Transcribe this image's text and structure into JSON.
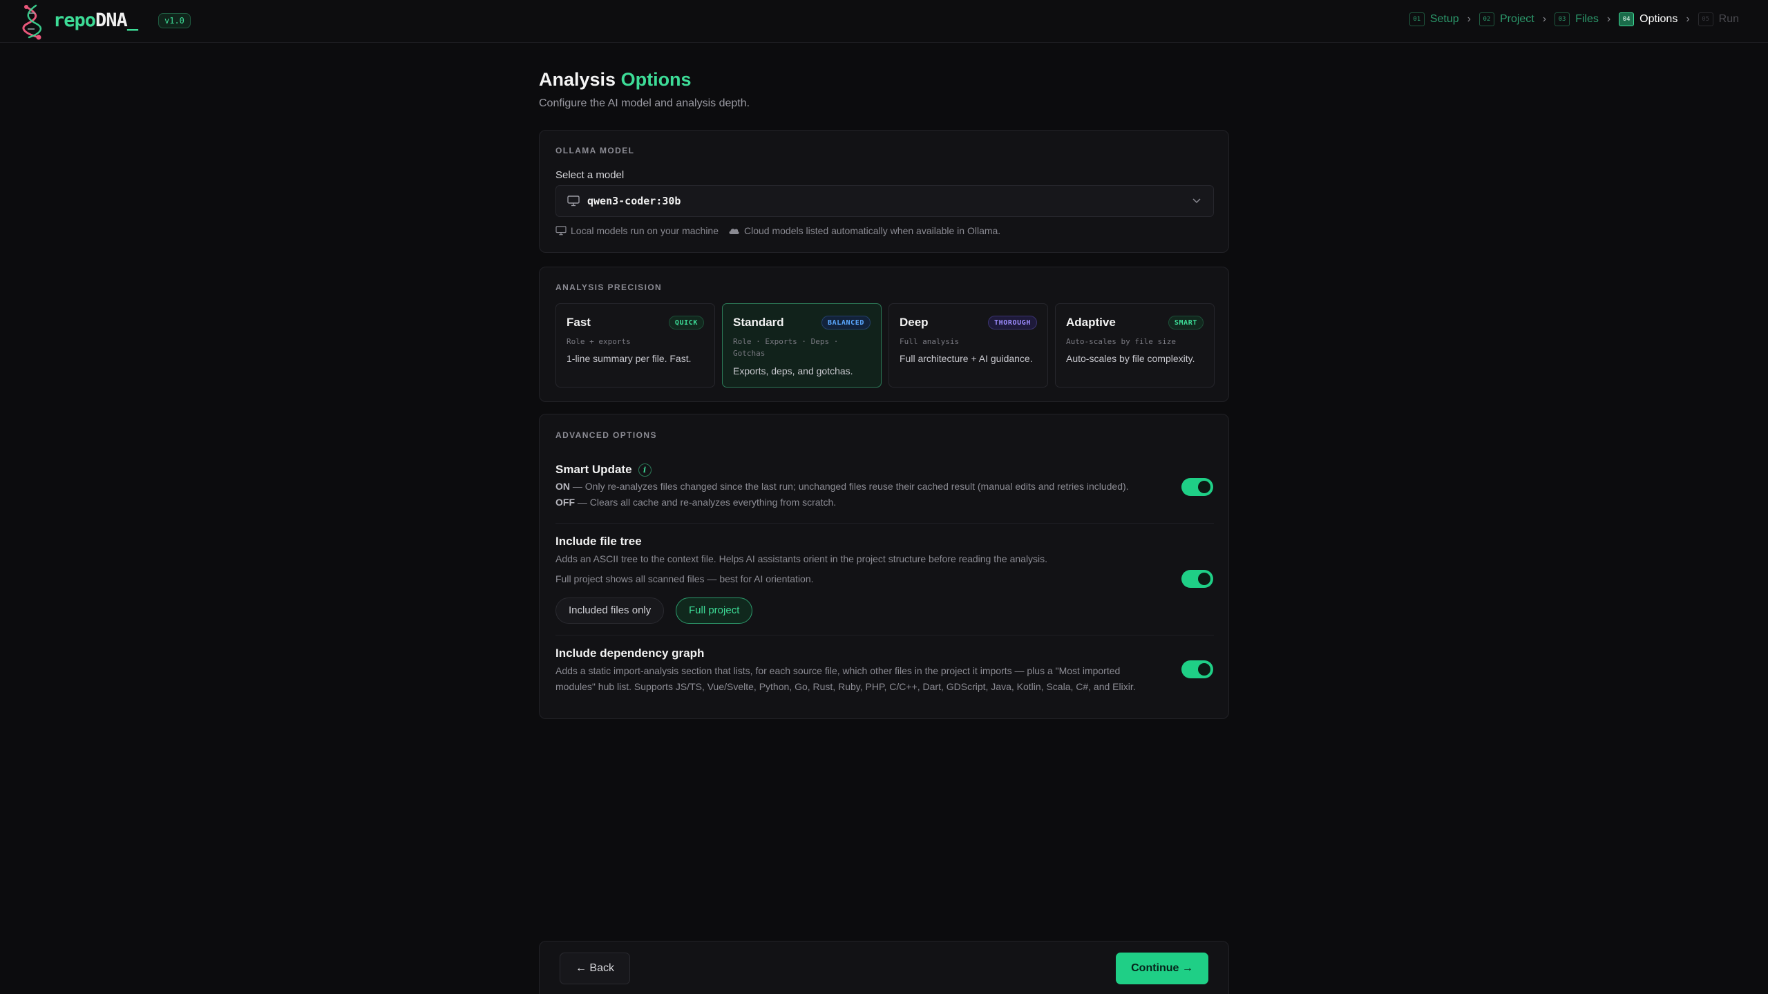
{
  "app": {
    "logo_repo": "repo",
    "logo_dna": "DNA",
    "logo_cursor": "_",
    "version": "v1.0"
  },
  "steps": [
    {
      "num": "01",
      "label": "Setup",
      "state": "done"
    },
    {
      "num": "02",
      "label": "Project",
      "state": "done"
    },
    {
      "num": "03",
      "label": "Files",
      "state": "done"
    },
    {
      "num": "04",
      "label": "Options",
      "state": "active"
    },
    {
      "num": "05",
      "label": "Run",
      "state": "future"
    }
  ],
  "step_separator": "›",
  "page": {
    "title_part1": "Analysis",
    "title_part2": "Options",
    "subtitle": "Configure the AI model and analysis depth."
  },
  "model": {
    "section_label": "OLLAMA MODEL",
    "select_label": "Select a model",
    "selected_value": "qwen3-coder:30b",
    "hint_local": "Local models run on your machine",
    "hint_cloud": "Cloud models listed automatically when available in Ollama."
  },
  "precision": {
    "section_label": "ANALYSIS PRECISION",
    "selected": "Standard",
    "tiles": [
      {
        "name": "Fast",
        "badge": "QUICK",
        "meta": "Role + exports",
        "desc": "1-line summary per file. Fast."
      },
      {
        "name": "Standard",
        "badge": "BALANCED",
        "meta": "Role · Exports · Deps · Gotchas",
        "desc": "Exports, deps, and gotchas."
      },
      {
        "name": "Deep",
        "badge": "THOROUGH",
        "meta": "Full analysis",
        "desc": "Full architecture + AI guidance."
      },
      {
        "name": "Adaptive",
        "badge": "SMART",
        "meta": "Auto-scales by file size",
        "desc": "Auto-scales by file complexity."
      }
    ]
  },
  "advanced": {
    "section_label": "ADVANCED OPTIONS",
    "smart_update": {
      "title": "Smart Update",
      "info": "i",
      "on_label": "ON",
      "on_text": "— Only re-analyzes files changed since the last run; unchanged files reuse their cached result (manual edits and retries included).",
      "off_label": "OFF",
      "off_text": "— Clears all cache and re-analyzes everything from scratch.",
      "enabled": true
    },
    "file_tree": {
      "title": "Include file tree",
      "desc": "Adds an ASCII tree to the context file. Helps AI assistants orient in the project structure before reading the analysis.",
      "mode_desc": "Full project shows all scanned files — best for AI orientation.",
      "option_included": "Included files only",
      "option_full": "Full project",
      "selected": "Full project",
      "enabled": true
    },
    "dep_graph": {
      "title": "Include dependency graph",
      "desc": "Adds a static import-analysis section that lists, for each source file, which other files in the project it imports — plus a \"Most imported modules\" hub list. Supports JS/TS, Vue/Svelte, Python, Go, Rust, Ruby, PHP, C/C++, Dart, GDScript, Java, Kotlin, Scala, C#, and Elixir.",
      "enabled": true
    }
  },
  "footer": {
    "back_label": "← Back",
    "continue_label": "Continue →"
  },
  "colors": {
    "accent": "#3ddc97",
    "toggle_on": "#1fcf86",
    "background": "#0c0c0e"
  }
}
